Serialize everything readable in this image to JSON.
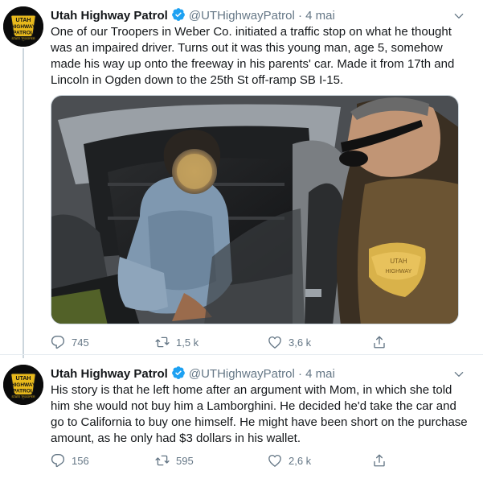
{
  "tweets": [
    {
      "author_name": "Utah Highway Patrol",
      "handle": "@UTHighwayPatrol",
      "separator": "·",
      "date": "4 mai",
      "text": "One of our Troopers in Weber Co. initiated a traffic stop on what he thought was an impaired driver. Turns out it was this young man, age 5, somehow made his way up onto the freeway in his parents' car. Made it from 17th and Lincoln in Ogden down to the 25th St off-ramp SB I-15.",
      "replies": "745",
      "retweets": "1,5 k",
      "likes": "3,6 k"
    },
    {
      "author_name": "Utah Highway Patrol",
      "handle": "@UTHighwayPatrol",
      "separator": "·",
      "date": "4 mai",
      "text": "His story is that he left home after an argument with Mom, in which she told him she would not buy him a Lamborghini. He decided he'd take the car and go to California to buy one himself. He might have been short on the purchase amount, as he only had $3 dollars in his wallet.",
      "replies": "156",
      "retweets": "595",
      "likes": "2,6 k"
    }
  ],
  "avatar_badge": {
    "top": "UTAH",
    "middle": "HIGHWAY",
    "bottom": "PATROL",
    "ribbon": "STATE TROOPER"
  },
  "colors": {
    "text": "#14171a",
    "secondary": "#657786",
    "verified": "#1da1f2",
    "badge_gold": "#e8b91c",
    "divider": "#e6ecf0"
  },
  "icons": [
    "reply-icon",
    "retweet-icon",
    "like-icon",
    "share-icon",
    "chevron-down-icon",
    "verified-icon"
  ]
}
